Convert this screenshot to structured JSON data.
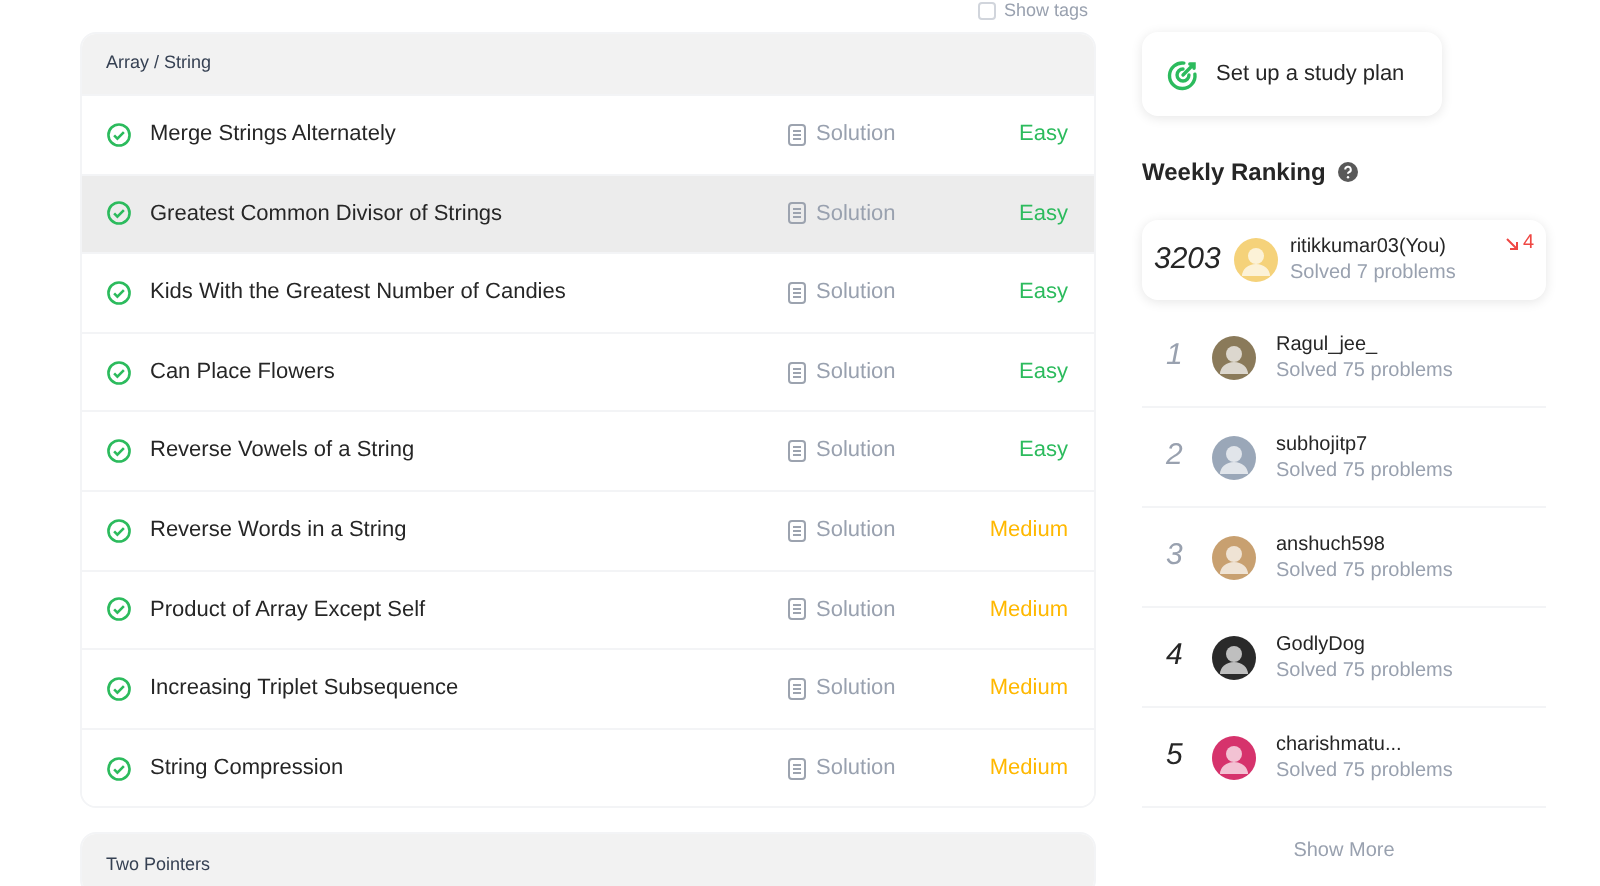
{
  "show_tags": {
    "label": "Show tags",
    "checked": false
  },
  "sections": [
    {
      "title": "Array / String",
      "problems": [
        {
          "title": "Merge Strings Alternately",
          "solved": true,
          "solution": "Solution",
          "difficulty": "Easy",
          "highlighted": false
        },
        {
          "title": "Greatest Common Divisor of Strings",
          "solved": true,
          "solution": "Solution",
          "difficulty": "Easy",
          "highlighted": true
        },
        {
          "title": "Kids With the Greatest Number of Candies",
          "solved": true,
          "solution": "Solution",
          "difficulty": "Easy",
          "highlighted": false
        },
        {
          "title": "Can Place Flowers",
          "solved": true,
          "solution": "Solution",
          "difficulty": "Easy",
          "highlighted": false
        },
        {
          "title": "Reverse Vowels of a String",
          "solved": true,
          "solution": "Solution",
          "difficulty": "Easy",
          "highlighted": false
        },
        {
          "title": "Reverse Words in a String",
          "solved": true,
          "solution": "Solution",
          "difficulty": "Medium",
          "highlighted": false
        },
        {
          "title": "Product of Array Except Self",
          "solved": true,
          "solution": "Solution",
          "difficulty": "Medium",
          "highlighted": false
        },
        {
          "title": "Increasing Triplet Subsequence",
          "solved": true,
          "solution": "Solution",
          "difficulty": "Medium",
          "highlighted": false
        },
        {
          "title": "String Compression",
          "solved": true,
          "solution": "Solution",
          "difficulty": "Medium",
          "highlighted": false
        }
      ]
    },
    {
      "title": "Two Pointers"
    }
  ],
  "study_plan": {
    "label": "Set up a study plan"
  },
  "weekly_ranking": {
    "title": "Weekly Ranking",
    "me": {
      "rank": "3203",
      "name": "ritikkumar03(You)",
      "solved": "Solved 7 problems",
      "change": "4"
    },
    "entries": [
      {
        "rank": "1",
        "name": "Ragul_jee_",
        "solved": "Solved 75 problems",
        "top": true
      },
      {
        "rank": "2",
        "name": "subhojitp7",
        "solved": "Solved 75 problems",
        "top": true
      },
      {
        "rank": "3",
        "name": "anshuch598",
        "solved": "Solved 75 problems",
        "top": true
      },
      {
        "rank": "4",
        "name": "GodlyDog",
        "solved": "Solved 75 problems",
        "top": false
      },
      {
        "rank": "5",
        "name": "charishmatu...",
        "solved": "Solved 75 problems",
        "top": false
      }
    ],
    "show_more": "Show More"
  }
}
